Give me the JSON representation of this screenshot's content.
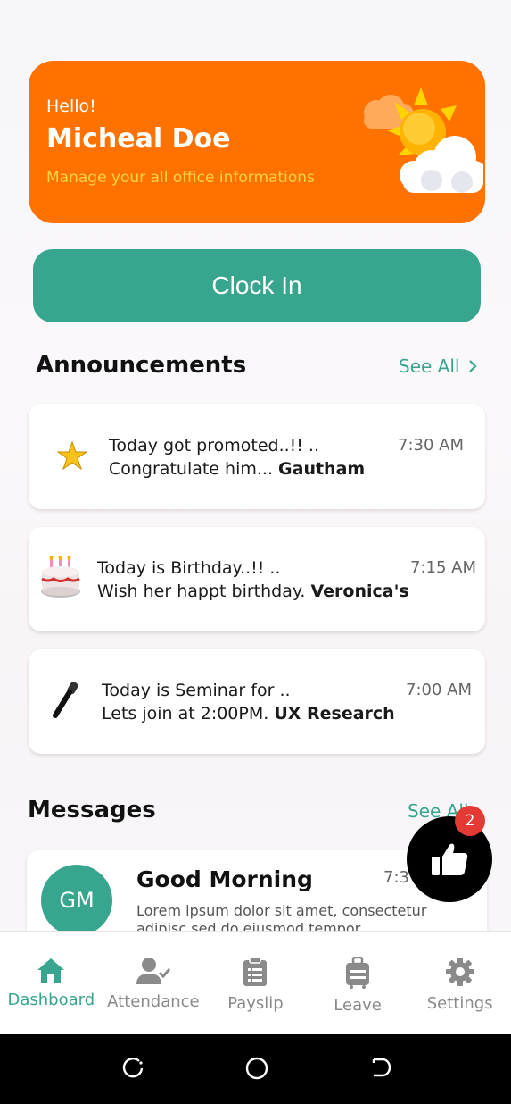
{
  "header": {
    "greeting": "Hello!",
    "user_name": "Micheal Doe",
    "subtitle": "Manage your all office informations"
  },
  "clock_in": {
    "label": "Clock In"
  },
  "announcements": {
    "title": "Announcements",
    "see_all": "See All",
    "items": [
      {
        "icon": "star-icon",
        "line1": "Today got promoted..!! ..",
        "line2_prefix": "Congratulate him... ",
        "line2_bold": "Gautham",
        "time": "7:30 AM"
      },
      {
        "icon": "birthday-cake-icon",
        "line1": "Today is Birthday..!! ..",
        "line2_prefix": "Wish her happt birthday. ",
        "line2_bold": "Veronica's",
        "time": "7:15 AM"
      },
      {
        "icon": "microphone-icon",
        "line1": "Today is Seminar for ..",
        "line2_prefix": "Lets join at 2:00PM. ",
        "line2_bold": "UX Research",
        "time": "7:00 AM"
      }
    ]
  },
  "messages": {
    "title": "Messages",
    "see_all": "See All",
    "items": [
      {
        "avatar": "GM",
        "title": "Good Morning",
        "time": "7:3",
        "body": "Lorem ipsum dolor sit amet, consectetur adipisc sed do eiusmod tempor"
      }
    ]
  },
  "fab": {
    "badge_count": "2",
    "icon": "thumbs-up-icon"
  },
  "bottom_nav": {
    "items": [
      {
        "label": "Dashboard",
        "icon": "home-icon",
        "active": true
      },
      {
        "label": "Attendance",
        "icon": "user-check-icon",
        "active": false
      },
      {
        "label": "Payslip",
        "icon": "clipboard-icon",
        "active": false
      },
      {
        "label": "Leave",
        "icon": "luggage-icon",
        "active": false
      },
      {
        "label": "Settings",
        "icon": "gear-icon",
        "active": false
      }
    ]
  },
  "colors": {
    "accent": "#38a68f",
    "hero": "#ff7200",
    "subtitle": "#ffd24a",
    "badge": "#e53935"
  }
}
